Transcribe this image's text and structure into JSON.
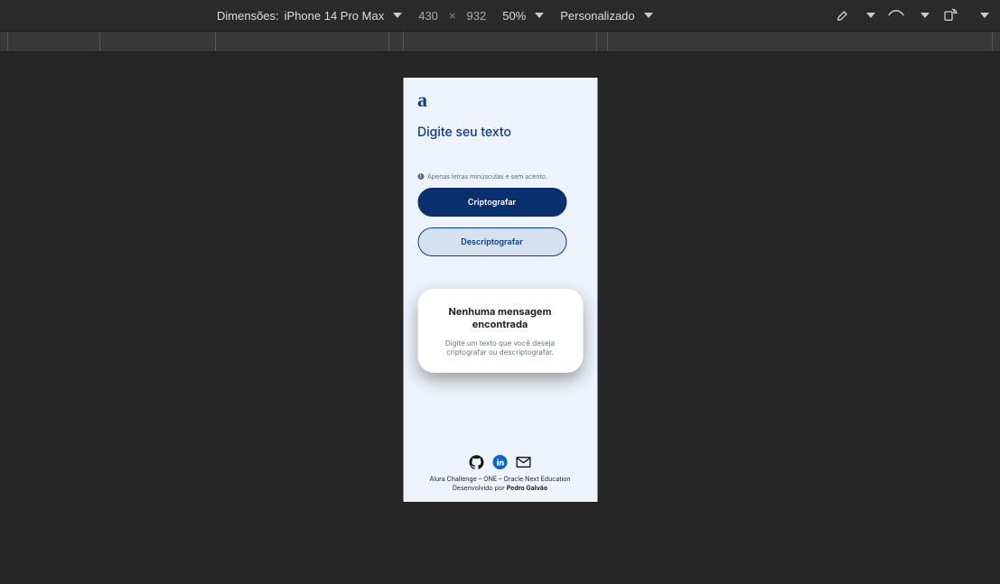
{
  "toolbar": {
    "dimensions_label": "Dimensões:",
    "device_name": "iPhone 14 Pro Max",
    "width": "430",
    "height": "932",
    "zoom": "50%",
    "throttle": "Personalizado"
  },
  "app": {
    "logo_glyph": "a",
    "heading": "Digite seu texto",
    "hint": "Apenas letras minúsculas e sem acento.",
    "encrypt_label": "Criptografar",
    "decrypt_label": "Descriptografar",
    "result": {
      "title": "Nenhuma mensagem encontrada",
      "subtitle": "Digite um texto que você deseja criptografar ou descriptografar."
    },
    "footer": {
      "line1": "Alura Challenge – ONE – Oracle Next Education",
      "line2_prefix": "Desenvolvido por ",
      "author": "Pedro Galvão"
    }
  },
  "colors": {
    "brand": "#0a3a8a",
    "brand_dark": "#0a2f6e",
    "page_bg": "#eef3fb"
  }
}
